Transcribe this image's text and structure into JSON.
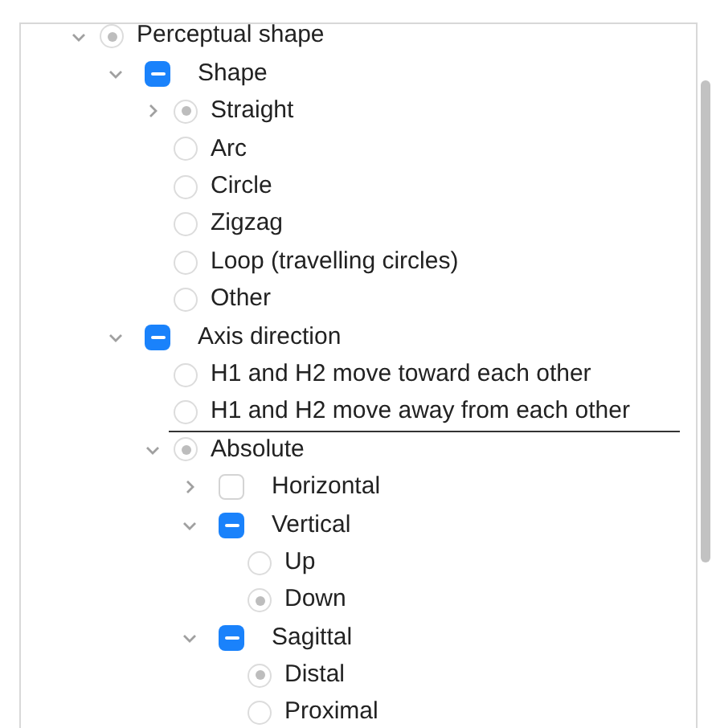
{
  "tree": [
    {
      "label": "Perceptual shape",
      "kind": "radio",
      "selected": true,
      "expanded": true,
      "children": [
        {
          "label": "Shape",
          "kind": "checkbox",
          "indeterminate": true,
          "expanded": true,
          "children": [
            {
              "label": "Straight",
              "kind": "radio",
              "selected": true,
              "expanded": false
            },
            {
              "label": "Arc",
              "kind": "radio",
              "selected": false
            },
            {
              "label": "Circle",
              "kind": "radio",
              "selected": false
            },
            {
              "label": "Zigzag",
              "kind": "radio",
              "selected": false
            },
            {
              "label": "Loop (travelling circles)",
              "kind": "radio",
              "selected": false
            },
            {
              "label": "Other",
              "kind": "radio",
              "selected": false
            }
          ]
        },
        {
          "label": "Axis direction",
          "kind": "checkbox",
          "indeterminate": true,
          "expanded": true,
          "children": [
            {
              "label": "H1 and H2 move toward each other",
              "kind": "radio",
              "selected": false
            },
            {
              "label": "H1 and H2 move away from each other",
              "kind": "radio",
              "selected": false,
              "drop_line_below": true
            },
            {
              "label": "Absolute",
              "kind": "radio",
              "selected": true,
              "expanded": true,
              "children": [
                {
                  "label": "Horizontal",
                  "kind": "checkbox",
                  "indeterminate": false,
                  "expanded": false
                },
                {
                  "label": "Vertical",
                  "kind": "checkbox",
                  "indeterminate": true,
                  "expanded": true,
                  "children": [
                    {
                      "label": "Up",
                      "kind": "radio",
                      "selected": false
                    },
                    {
                      "label": "Down",
                      "kind": "radio",
                      "selected": true
                    }
                  ]
                },
                {
                  "label": "Sagittal",
                  "kind": "checkbox",
                  "indeterminate": true,
                  "expanded": true,
                  "children": [
                    {
                      "label": "Distal",
                      "kind": "radio",
                      "selected": true
                    },
                    {
                      "label": "Proximal",
                      "kind": "radio",
                      "selected": false
                    }
                  ]
                }
              ]
            }
          ]
        }
      ]
    }
  ]
}
